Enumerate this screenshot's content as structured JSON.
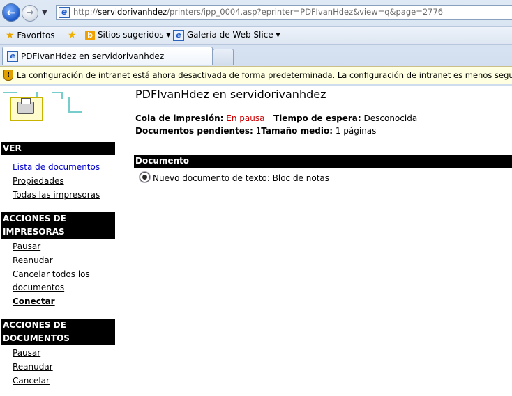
{
  "browser": {
    "address_url_prefix": "http://",
    "address_url_host": "servidorivanhdez",
    "address_url_path": "/printers/ipp_0004.asp?eprinter=PDFIvanHdez&view=q&page=2776",
    "favorites_label": "Favoritos",
    "suggested_sites_label": "Sitios sugeridos ▾",
    "web_slice_label": "Galería de Web Slice ▾",
    "tab_title": "PDFIvanHdez en servidorivanhdez",
    "infobar_text": "La configuración de intranet está ahora desactivada de forma predeterminada. La configuración de intranet es menos segura que la configuración de Internet."
  },
  "sidebar": {
    "ver_header": "VER",
    "ver_items": [
      "Lista de documentos",
      "Propiedades",
      "Todas las impresoras"
    ],
    "printer_actions_header_1": "ACCIONES DE",
    "printer_actions_header_2": "IMPRESORAS",
    "printer_actions": [
      "Pausar",
      "Reanudar",
      "Cancelar todos los",
      "documentos",
      "Conectar"
    ],
    "doc_actions_header_1": "ACCIONES DE",
    "doc_actions_header_2": "DOCUMENTOS",
    "doc_actions": [
      "Pausar",
      "Reanudar",
      "Cancelar"
    ]
  },
  "main": {
    "title": "PDFIvanHdez en servidorivanhdez",
    "queue_label": "Cola de impresión:",
    "queue_value": "En pausa",
    "wait_label": "Tiempo de espera:",
    "wait_value": "Desconocida",
    "pending_label": "Documentos pendientes:",
    "pending_value": "1",
    "avg_label": "Tamaño medio:",
    "avg_value": "1 páginas",
    "doc_column_header": "Documento",
    "documents": [
      "Nuevo documento de texto: Bloc de notas"
    ]
  },
  "colors": {
    "link": "#0000cc",
    "header_bg": "#000000",
    "status_red": "#cc0000",
    "infobar_bg": "#ffffe1"
  }
}
